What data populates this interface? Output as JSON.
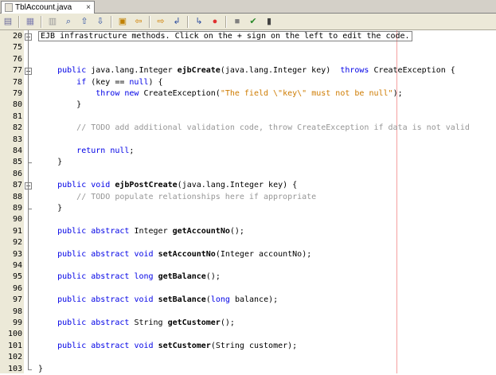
{
  "tab": {
    "title": "TblAccount.java",
    "close": "×"
  },
  "toolbar": {
    "icons": [
      "previous-edit-icon",
      "history-icon",
      "navigation-icon",
      "find-icon",
      "find-previous-icon",
      "find-next-icon",
      "toggle-highlight-icon",
      "shift-left-icon",
      "shift-right-icon",
      "toggle-comment-icon",
      "uncomment-icon",
      "start-macro-icon",
      "stop-macro-icon",
      "run-icon",
      "stop-icon"
    ]
  },
  "lines": [
    {
      "n": "20",
      "fold": "+",
      "code": [
        {
          "t": "EJB infrastructure methods. Click on the + sign on the left to edit the code.",
          "c": "collapsed"
        }
      ]
    },
    {
      "n": "75",
      "code": []
    },
    {
      "n": "76",
      "code": []
    },
    {
      "n": "77",
      "fold": "-",
      "code": [
        {
          "t": "    "
        },
        {
          "t": "public",
          "c": "kw"
        },
        {
          "t": " java.lang.Integer "
        },
        {
          "t": "ejbCreate",
          "c": "bold"
        },
        {
          "t": "(java.lang.Integer key)  "
        },
        {
          "t": "throws",
          "c": "kw"
        },
        {
          "t": " CreateException {"
        }
      ]
    },
    {
      "n": "78",
      "code": [
        {
          "t": "        "
        },
        {
          "t": "if",
          "c": "kw"
        },
        {
          "t": " (key == "
        },
        {
          "t": "null",
          "c": "kw"
        },
        {
          "t": ") {"
        }
      ]
    },
    {
      "n": "79",
      "code": [
        {
          "t": "            "
        },
        {
          "t": "throw",
          "c": "kw"
        },
        {
          "t": " "
        },
        {
          "t": "new",
          "c": "kw"
        },
        {
          "t": " CreateException("
        },
        {
          "t": "\"The field \\\"key\\\" must not be null\"",
          "c": "str"
        },
        {
          "t": ");"
        }
      ]
    },
    {
      "n": "80",
      "code": [
        {
          "t": "        }"
        }
      ]
    },
    {
      "n": "81",
      "code": []
    },
    {
      "n": "82",
      "code": [
        {
          "t": "        "
        },
        {
          "t": "// TODO add additional validation code, throw CreateException if data is not valid",
          "c": "cm"
        }
      ]
    },
    {
      "n": "83",
      "code": []
    },
    {
      "n": "84",
      "code": [
        {
          "t": "        "
        },
        {
          "t": "return",
          "c": "kw"
        },
        {
          "t": " "
        },
        {
          "t": "null",
          "c": "kw"
        },
        {
          "t": ";"
        }
      ]
    },
    {
      "n": "85",
      "code": [
        {
          "t": "    }"
        }
      ]
    },
    {
      "n": "86",
      "code": []
    },
    {
      "n": "87",
      "fold": "-",
      "code": [
        {
          "t": "    "
        },
        {
          "t": "public",
          "c": "kw"
        },
        {
          "t": " "
        },
        {
          "t": "void",
          "c": "kw"
        },
        {
          "t": " "
        },
        {
          "t": "ejbPostCreate",
          "c": "bold"
        },
        {
          "t": "(java.lang.Integer key) {"
        }
      ]
    },
    {
      "n": "88",
      "code": [
        {
          "t": "        "
        },
        {
          "t": "// TODO populate relationships here if appropriate",
          "c": "cm"
        }
      ]
    },
    {
      "n": "89",
      "code": [
        {
          "t": "    }"
        }
      ]
    },
    {
      "n": "90",
      "code": []
    },
    {
      "n": "91",
      "code": [
        {
          "t": "    "
        },
        {
          "t": "public",
          "c": "kw"
        },
        {
          "t": " "
        },
        {
          "t": "abstract",
          "c": "kw"
        },
        {
          "t": " Integer "
        },
        {
          "t": "getAccountNo",
          "c": "bold"
        },
        {
          "t": "();"
        }
      ]
    },
    {
      "n": "92",
      "code": []
    },
    {
      "n": "93",
      "code": [
        {
          "t": "    "
        },
        {
          "t": "public",
          "c": "kw"
        },
        {
          "t": " "
        },
        {
          "t": "abstract",
          "c": "kw"
        },
        {
          "t": " "
        },
        {
          "t": "void",
          "c": "kw"
        },
        {
          "t": " "
        },
        {
          "t": "setAccountNo",
          "c": "bold"
        },
        {
          "t": "(Integer accountNo);"
        }
      ]
    },
    {
      "n": "94",
      "code": []
    },
    {
      "n": "95",
      "code": [
        {
          "t": "    "
        },
        {
          "t": "public",
          "c": "kw"
        },
        {
          "t": " "
        },
        {
          "t": "abstract",
          "c": "kw"
        },
        {
          "t": " "
        },
        {
          "t": "long",
          "c": "kw"
        },
        {
          "t": " "
        },
        {
          "t": "getBalance",
          "c": "bold"
        },
        {
          "t": "();"
        }
      ]
    },
    {
      "n": "96",
      "code": []
    },
    {
      "n": "97",
      "code": [
        {
          "t": "    "
        },
        {
          "t": "public",
          "c": "kw"
        },
        {
          "t": " "
        },
        {
          "t": "abstract",
          "c": "kw"
        },
        {
          "t": " "
        },
        {
          "t": "void",
          "c": "kw"
        },
        {
          "t": " "
        },
        {
          "t": "setBalance",
          "c": "bold"
        },
        {
          "t": "("
        },
        {
          "t": "long",
          "c": "kw"
        },
        {
          "t": " balance);"
        }
      ]
    },
    {
      "n": "98",
      "code": []
    },
    {
      "n": "99",
      "code": [
        {
          "t": "    "
        },
        {
          "t": "public",
          "c": "kw"
        },
        {
          "t": " "
        },
        {
          "t": "abstract",
          "c": "kw"
        },
        {
          "t": " String "
        },
        {
          "t": "getCustomer",
          "c": "bold"
        },
        {
          "t": "();"
        }
      ]
    },
    {
      "n": "100",
      "code": []
    },
    {
      "n": "101",
      "code": [
        {
          "t": "    "
        },
        {
          "t": "public",
          "c": "kw"
        },
        {
          "t": " "
        },
        {
          "t": "abstract",
          "c": "kw"
        },
        {
          "t": " "
        },
        {
          "t": "void",
          "c": "kw"
        },
        {
          "t": " "
        },
        {
          "t": "setCustomer",
          "c": "bold"
        },
        {
          "t": "(String customer);"
        }
      ]
    },
    {
      "n": "102",
      "code": []
    },
    {
      "n": "103",
      "code": [
        {
          "t": "}"
        }
      ]
    }
  ],
  "colors": {
    "keyword": "#0000e6",
    "string": "#ce7b00",
    "comment": "#969696",
    "margin": "#f4a0a0"
  }
}
